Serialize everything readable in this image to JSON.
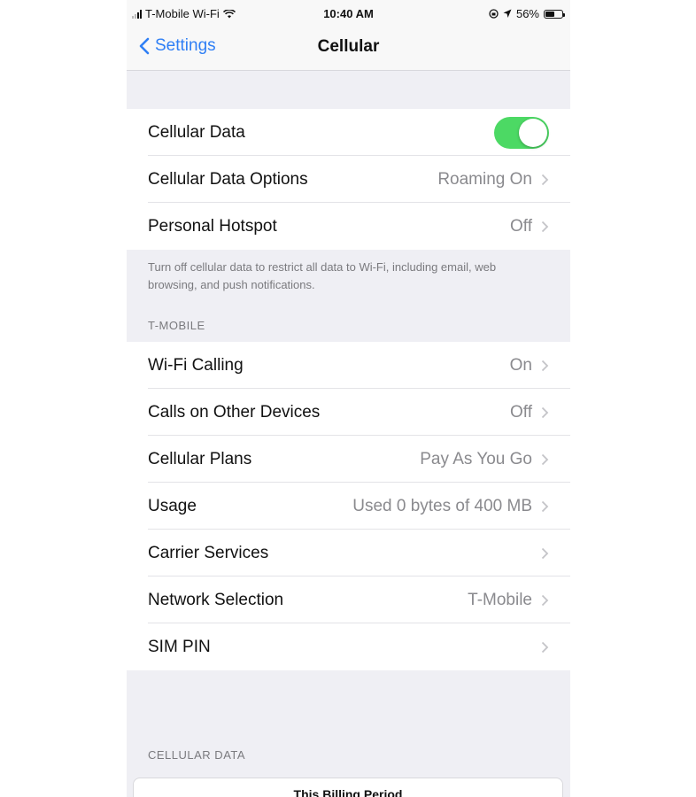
{
  "status_bar": {
    "carrier": "T-Mobile Wi-Fi",
    "time": "10:40 AM",
    "battery_percent": "56%",
    "battery_level": 0.56
  },
  "nav": {
    "back_label": "Settings",
    "title": "Cellular"
  },
  "group1": [
    {
      "label": "Cellular Data",
      "toggle": true
    },
    {
      "label": "Cellular Data Options",
      "value": "Roaming On"
    },
    {
      "label": "Personal Hotspot",
      "value": "Off"
    }
  ],
  "group1_footer": "Turn off cellular data to restrict all data to Wi-Fi, including email, web browsing, and push notifications.",
  "carrier_header": "T-MOBILE",
  "group2": [
    {
      "label": "Wi-Fi Calling",
      "value": "On"
    },
    {
      "label": "Calls on Other Devices",
      "value": "Off"
    },
    {
      "label": "Cellular Plans",
      "value": "Pay As You Go"
    },
    {
      "label": "Usage",
      "value": "Used 0 bytes of 400 MB"
    },
    {
      "label": "Carrier Services",
      "value": ""
    },
    {
      "label": "Network Selection",
      "value": "T-Mobile"
    },
    {
      "label": "SIM PIN",
      "value": ""
    }
  ],
  "cellular_data_header": "CELLULAR DATA",
  "billing_card_title": "This Billing Period",
  "colors": {
    "accent": "#2f7ff5",
    "toggle_on": "#4cd964",
    "grouped_background": "#efeff4"
  }
}
